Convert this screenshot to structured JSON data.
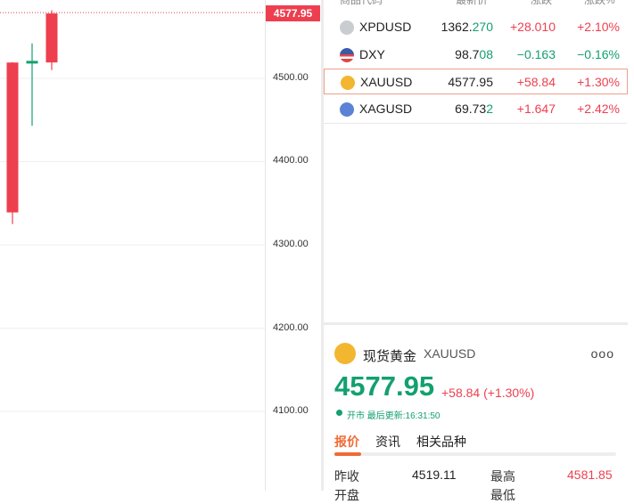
{
  "chart": {
    "current_price_tag": "4577.95",
    "y_axis_labels": [
      "4500.00",
      "4400.00",
      "4300.00",
      "4200.00",
      "4100.00"
    ],
    "chart_data": {
      "type": "candlestick",
      "candles": [
        {
          "open": 4519.0,
          "high": 4519.5,
          "low": 4325.0,
          "close": 4339.0
        },
        {
          "open": 4519.0,
          "high": 4542.0,
          "low": 4443.0,
          "close": 4521.0
        },
        {
          "open": 4519.11,
          "high": 4581.85,
          "low": 4510.0,
          "close": 4577.95
        }
      ],
      "ylim": [
        4080,
        4580
      ]
    }
  },
  "watchlist": {
    "headers": {
      "code": "商品代码",
      "last": "最新价",
      "chg": "涨跌",
      "pct": "涨跌%"
    },
    "rows": [
      {
        "symbol": "XPDUSD",
        "last_main": "1362.",
        "last_tail": "270",
        "chg": "+28.010",
        "pct": "+2.10%",
        "dir": "up",
        "icon": "palladium-icon",
        "icon_color": "#b9bcc2"
      },
      {
        "symbol": "DXY",
        "last_main": "98.7",
        "last_tail": "08",
        "chg": "−0.163",
        "pct": "−0.16%",
        "dir": "dn",
        "icon": "us-flag-icon",
        "icon_color": "#3b5aa8"
      },
      {
        "symbol": "XAUUSD",
        "last_main": "4577.95",
        "last_tail": "",
        "chg": "+58.84",
        "pct": "+1.30%",
        "dir": "up",
        "icon": "gold-icon",
        "icon_color": "#f2b630"
      },
      {
        "symbol": "XAGUSD",
        "last_main": "69.73",
        "last_tail": "2",
        "chg": "+1.647",
        "pct": "+2.42%",
        "dir": "up",
        "icon": "silver-icon",
        "icon_color": "#5b82d4"
      }
    ]
  },
  "detail": {
    "name": "现货黄金",
    "code": "XAUUSD",
    "more": "ooo",
    "price": "4577.95",
    "change": "+58.84 (+1.30%)",
    "status": "开市  最后更新:16:31:50",
    "tabs": [
      "报价",
      "资讯",
      "相关品种"
    ],
    "stats": {
      "prev_close_label": "昨收",
      "prev_close": "4519.11",
      "high_label": "最高",
      "high": "4581.85"
    },
    "peek_row": {
      "open_label": "开盘",
      "low_label": "最低"
    }
  },
  "colors": {
    "up": "#ee3f4f",
    "down": "#13a06f",
    "accent": "#f06a35"
  }
}
